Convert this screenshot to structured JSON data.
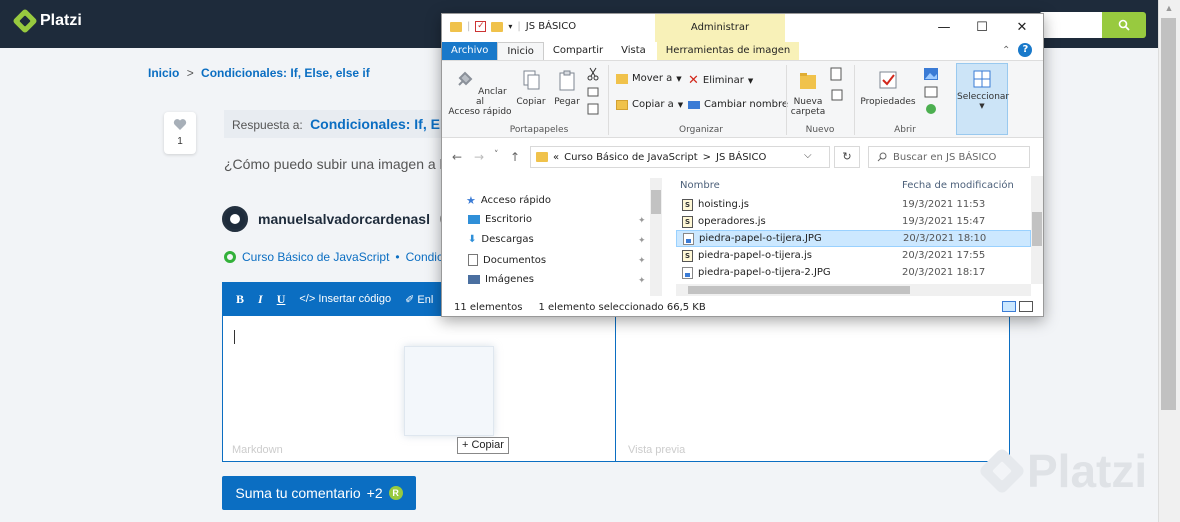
{
  "platzi": {
    "brand": "Platzi",
    "breadcrumb": {
      "home": "Inicio",
      "separator": ">",
      "current": "Condicionales: If, Else, else if"
    },
    "vote_count": "1",
    "reply_label": "Respuesta a:",
    "reply_title": "Condicionales: If, Else,",
    "question": "¿Cómo puedo subir una imagen a los",
    "username": "manuelsalvadorcardenasl",
    "user_badge": "R",
    "course_link": "Curso Básico de JavaScript",
    "course_sep": "•",
    "course_extra": "Condic",
    "editor": {
      "bold": "B",
      "italic": "I",
      "underline": "U",
      "insert_code": "</> Insertar código",
      "link": "✐ Enl",
      "markdown_label": "Markdown",
      "preview_label": "Vista previa",
      "drag_tooltip": "+ Copiar"
    },
    "submit": {
      "label": "Suma tu comentario",
      "points": "+2",
      "badge": "R"
    },
    "watermark": "Platzi",
    "colors": {
      "header": "#1e2b3b",
      "accent": "#98ca3f",
      "blue": "#0b6ec2"
    }
  },
  "explorer": {
    "title": "JS BÁSICO",
    "context_tab": "Administrar",
    "window_buttons": {
      "minimize": "—",
      "maximize": "☐",
      "close": "✕"
    },
    "tabs": [
      "Archivo",
      "Inicio",
      "Compartir",
      "Vista",
      "Herramientas de imagen"
    ],
    "ribbon": {
      "pin": "Anclar al\nAcceso rápido",
      "copy": "Copiar",
      "paste": "Pegar",
      "move_to": "Mover a",
      "copy_to": "Copiar a",
      "delete": "Eliminar",
      "rename": "Cambiar nombre",
      "new_folder": "Nueva\ncarpeta",
      "properties": "Propiedades",
      "select": "Seleccionar",
      "groups": {
        "clipboard": "Portapapeles",
        "organize": "Organizar",
        "new": "Nuevo",
        "open": "Abrir"
      }
    },
    "address": {
      "prefix": "«",
      "part1": "Curso Básico de JavaScript",
      "sep": ">",
      "part2": "JS BÁSICO"
    },
    "search_placeholder": "Buscar en JS BÁSICO",
    "nav_items": [
      "Acceso rápido",
      "Escritorio",
      "Descargas",
      "Documentos",
      "Imágenes"
    ],
    "columns": {
      "name": "Nombre",
      "date": "Fecha de modificación"
    },
    "files": [
      {
        "name": "hoisting.js",
        "date": "19/3/2021 11:53",
        "type": "js"
      },
      {
        "name": "operadores.js",
        "date": "19/3/2021 15:47",
        "type": "js"
      },
      {
        "name": "piedra-papel-o-tijera.JPG",
        "date": "20/3/2021 18:10",
        "type": "jpg",
        "selected": true
      },
      {
        "name": "piedra-papel-o-tijera.js",
        "date": "20/3/2021 17:55",
        "type": "js"
      },
      {
        "name": "piedra-papel-o-tijera-2.JPG",
        "date": "20/3/2021 18:17",
        "type": "jpg"
      }
    ],
    "status": {
      "count": "11 elementos",
      "selected": "1 elemento seleccionado",
      "size": "66,5 KB"
    }
  }
}
